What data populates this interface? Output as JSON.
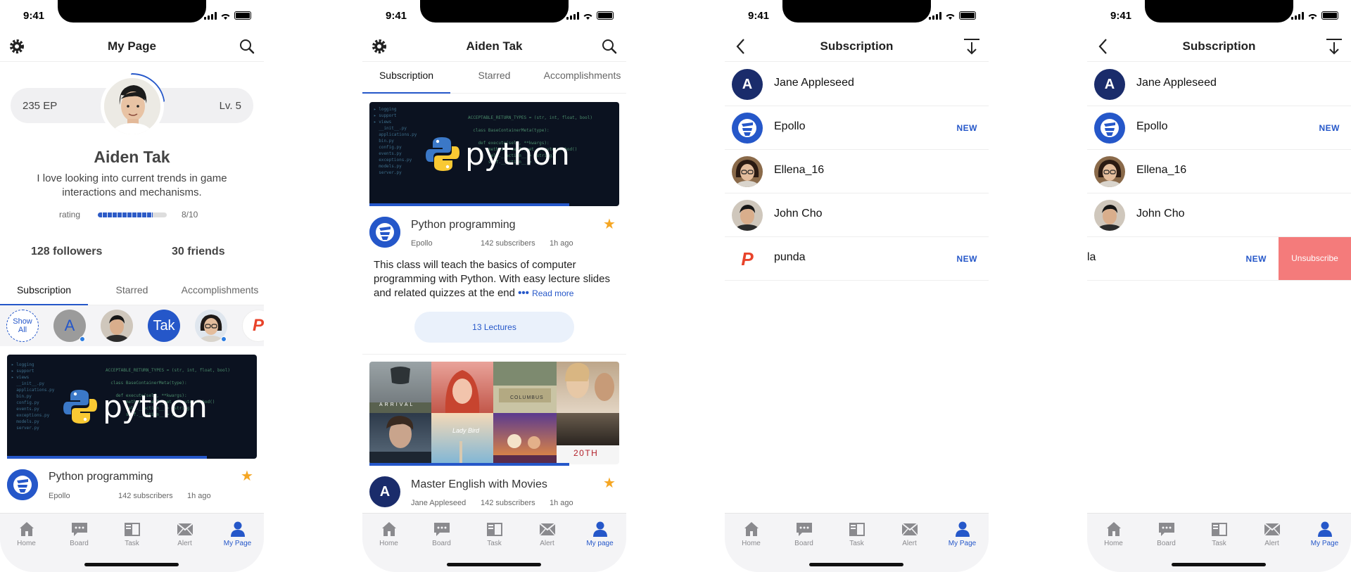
{
  "status": {
    "time": "9:41"
  },
  "tabbar": {
    "home": "Home",
    "board": "Board",
    "task": "Task",
    "alert": "Alert",
    "mypage": "My Page",
    "mypage_alt": "My page"
  },
  "screen1": {
    "title": "My Page",
    "ep": "235 EP",
    "level": "Lv. 5",
    "name": "Aiden Tak",
    "bio": "I love looking into current trends in game interactions and mechanisms.",
    "rating_label": "rating",
    "rating_value": "8/10",
    "rating_fraction": 0.8,
    "followers": "128 followers",
    "friends": "30 friends",
    "tabs": [
      "Subscription",
      "Starred",
      "Accomplishments"
    ],
    "show_all": "Show All",
    "avatars": {
      "a_letter": "A",
      "tak": "Tak"
    },
    "card": {
      "title": "Python programming",
      "channel": "Epollo",
      "subscribers": "142 subscribers",
      "time": "1h ago",
      "banner_text": "python",
      "progress": 0.8
    }
  },
  "screen2": {
    "title": "Aiden Tak",
    "tabs": [
      "Subscription",
      "Starred",
      "Accomplishments"
    ],
    "card1": {
      "title": "Python programming",
      "channel": "Epollo",
      "subscribers": "142 subscribers",
      "time": "1h ago",
      "banner_text": "python",
      "progress": 0.8,
      "desc": "This class will teach the basics of computer programming with Python. With easy lecture slides and related quizzes at the end",
      "readmore": "Read more",
      "lectures": "13 Lectures"
    },
    "card2": {
      "title": "Master English with Movies",
      "channel": "Jane Appleseed",
      "subscribers": "142 subscribers",
      "time": "1h ago",
      "avatar_letter": "A",
      "progress": 0.8,
      "posters": {
        "arrival": "ARRIVAL",
        "ladybird": "Lady Bird",
        "columbus": "COLUMBUS",
        "cent": "20TH"
      }
    }
  },
  "screen3": {
    "title": "Subscription",
    "rows": [
      {
        "name": "Jane Appleseed",
        "letter": "A",
        "new": ""
      },
      {
        "name": "Epollo",
        "new": "NEW"
      },
      {
        "name": "Ellena_16",
        "new": ""
      },
      {
        "name": "John Cho",
        "new": ""
      },
      {
        "name": "punda",
        "new": "NEW"
      }
    ]
  },
  "screen4": {
    "title": "Subscription",
    "rows": [
      {
        "name": "Jane Appleseed",
        "letter": "A",
        "new": ""
      },
      {
        "name": "Epollo",
        "new": "NEW"
      },
      {
        "name": "Ellena_16",
        "new": ""
      },
      {
        "name": "John Cho",
        "new": ""
      },
      {
        "name": "la",
        "new": "NEW"
      }
    ],
    "unsubscribe": "Unsubscribe"
  },
  "colors": {
    "accent": "#2557c9",
    "star": "#f5a623",
    "unsubscribe": "#f47b7b"
  }
}
